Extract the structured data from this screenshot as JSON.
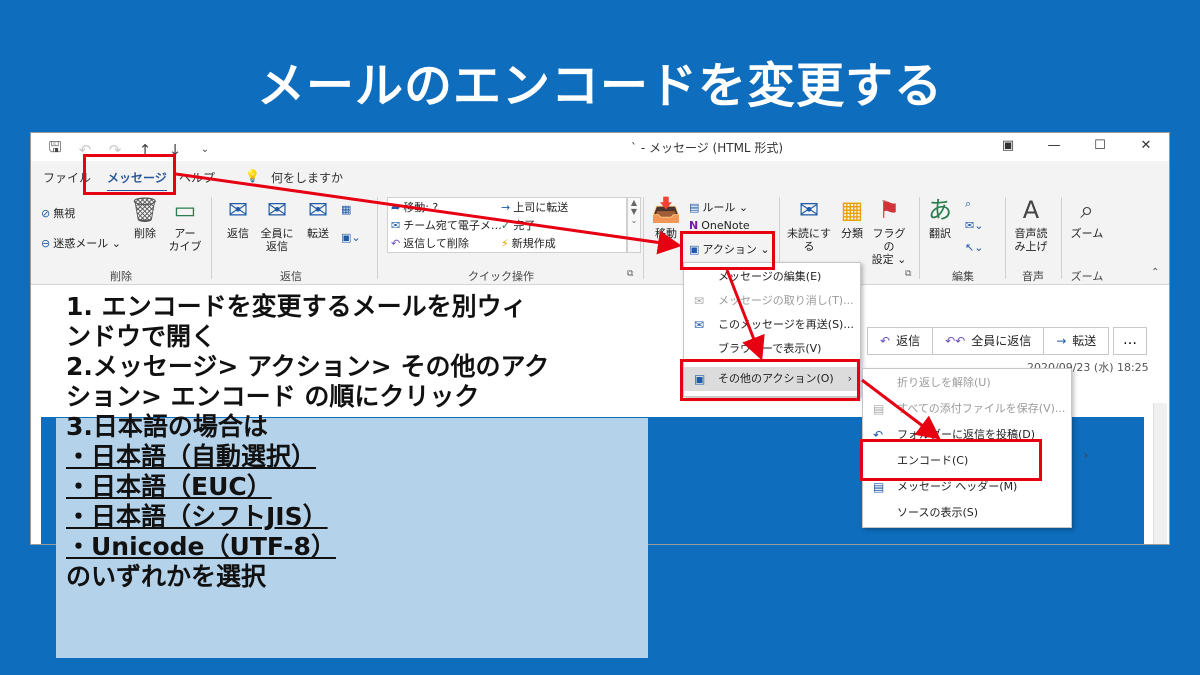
{
  "slide": {
    "title": "メールのエンコードを変更する"
  },
  "window": {
    "title": "` - メッセージ (HTML 形式)",
    "qat_icons": [
      "save-icon",
      "undo-icon",
      "redo-icon",
      "up-arrow-icon",
      "down-arrow-icon",
      "customize-icon"
    ],
    "controls": [
      "▣",
      "—",
      "☐",
      "✕"
    ]
  },
  "menubar": {
    "file": "ファイル",
    "message": "メッセージ",
    "help": "ヘルプ",
    "tell_me": "何をしますか"
  },
  "ribbon": {
    "delete_group": {
      "label": "削除",
      "ignore": "無視",
      "junk": "迷惑メール ⌄",
      "delete": "削除",
      "archive": "アー\nカイブ"
    },
    "respond_group": {
      "label": "返信",
      "reply": "返信",
      "reply_all": "全員に\n返信",
      "forward": "転送"
    },
    "quick_steps": {
      "label": "クイック操作",
      "move_to": "移動: ?",
      "team_mail": "チーム宛て電子メ…",
      "reply_delete": "返信して削除",
      "to_manager": "上司に転送",
      "done": "完了",
      "create_new": "新規作成"
    },
    "move_group": {
      "move": "移動",
      "rules": "ルール ⌄",
      "onenote": "OneNote",
      "actions": "アクション ⌄"
    },
    "tags_group": {
      "unread": "未読にする",
      "categorize": "分類",
      "follow_up": "フラグの\n設定 ⌄"
    },
    "editing_group": {
      "label": "編集",
      "translate": "翻訳"
    },
    "speech_group": {
      "label": "音声",
      "read_aloud": "音声読\nみ上げ"
    },
    "zoom_group": {
      "label": "ズーム",
      "zoom": "ズーム"
    }
  },
  "reply_bar": {
    "reply": "返信",
    "reply_all": "全員に返信",
    "forward": "転送",
    "more": "…"
  },
  "date": "2020/09/23 (水) 18:25",
  "actions_menu": [
    {
      "label": "メッセージの編集(E)",
      "disabled": false
    },
    {
      "label": "メッセージの取り消し(T)...",
      "disabled": true
    },
    {
      "label": "このメッセージを再送(S)...",
      "disabled": false
    },
    {
      "label": "ブラウザーで表示(V)",
      "disabled": false
    },
    {
      "label": "その他のアクション(O)",
      "disabled": false
    }
  ],
  "other_actions_menu": [
    {
      "label": "折り返しを解除(U)",
      "disabled": true
    },
    {
      "label": "すべての添付ファイルを保存(V)...",
      "disabled": true
    },
    {
      "label": "フォルダーに返信を投稿(D)",
      "disabled": false
    },
    {
      "label": "エンコード(C)",
      "disabled": false
    },
    {
      "label": "メッセージ ヘッダー(M)",
      "disabled": false
    },
    {
      "label": "ソースの表示(S)",
      "disabled": false
    }
  ],
  "instructions": {
    "line1": "1. エンコードを変更するメールを別ウィ",
    "line2": "ンドウで開く",
    "line3": "2.メッセージ> アクション> その他のアク",
    "line4": "ション> エンコード の順にクリック",
    "line5": "3.日本語の場合は",
    "opt1": "・日本語（自動選択）",
    "opt2": "・日本語（EUC）",
    "opt3": "・日本語（シフトJIS）",
    "opt4": "・Unicode（UTF-8）",
    "line10": "のいずれかを選択"
  },
  "colors": {
    "slide_bg": "#0E6DBD",
    "highlight": "#e60012",
    "instr_bg": "#B4D2EA"
  }
}
